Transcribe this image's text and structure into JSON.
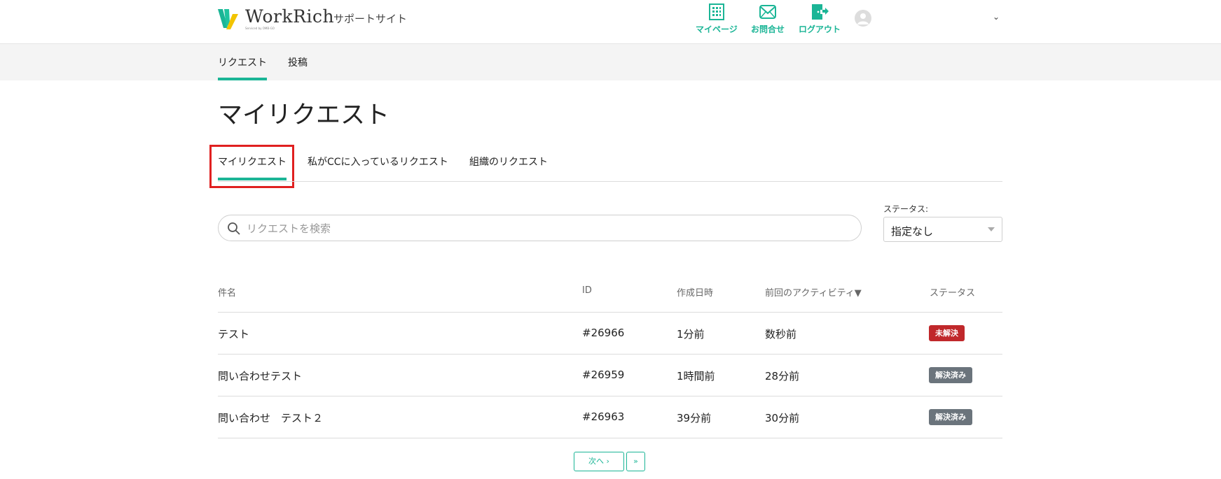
{
  "header": {
    "logo_name": "WorkRich",
    "logo_sub": "Serviced by OMB-GO",
    "site_name": "サポートサイト",
    "nav": [
      {
        "label": "マイページ",
        "icon": "building-icon"
      },
      {
        "label": "お問合せ",
        "icon": "mail-icon"
      },
      {
        "label": "ログアウト",
        "icon": "logout-icon"
      }
    ],
    "chevron": "⌄"
  },
  "subnav": {
    "items": [
      {
        "label": "リクエスト",
        "active": true
      },
      {
        "label": "投稿",
        "active": false
      }
    ]
  },
  "main": {
    "title": "マイリクエスト",
    "tabs": [
      {
        "label": "マイリクエスト",
        "active": true
      },
      {
        "label": "私がCCに入っているリクエスト",
        "active": false
      },
      {
        "label": "組織のリクエスト",
        "active": false
      }
    ],
    "search": {
      "placeholder": "リクエストを検索",
      "value": ""
    },
    "status_filter": {
      "label": "ステータス:",
      "value": "指定なし"
    }
  },
  "table": {
    "columns": [
      "件名",
      "ID",
      "作成日時",
      "前回のアクティビティ▼",
      "ステータス"
    ],
    "rows": [
      {
        "subject": "テスト",
        "id": "#26966",
        "created": "1分前",
        "last_activity": "数秒前",
        "status": "未解決"
      },
      {
        "subject": "問い合わせテスト",
        "id": "#26959",
        "created": "1時間前",
        "last_activity": "28分前",
        "status": "解決済み"
      },
      {
        "subject": "問い合わせ　テスト２",
        "id": "#26963",
        "created": "39分前",
        "last_activity": "30分前",
        "status": "解決済み"
      }
    ]
  },
  "pagination": {
    "next_label": "次へ ›",
    "last_label": "»"
  },
  "colors": {
    "accent": "#1bb596",
    "open_badge": "#c0282b",
    "solved_badge": "#6b747c",
    "highlight": "#e02020"
  }
}
